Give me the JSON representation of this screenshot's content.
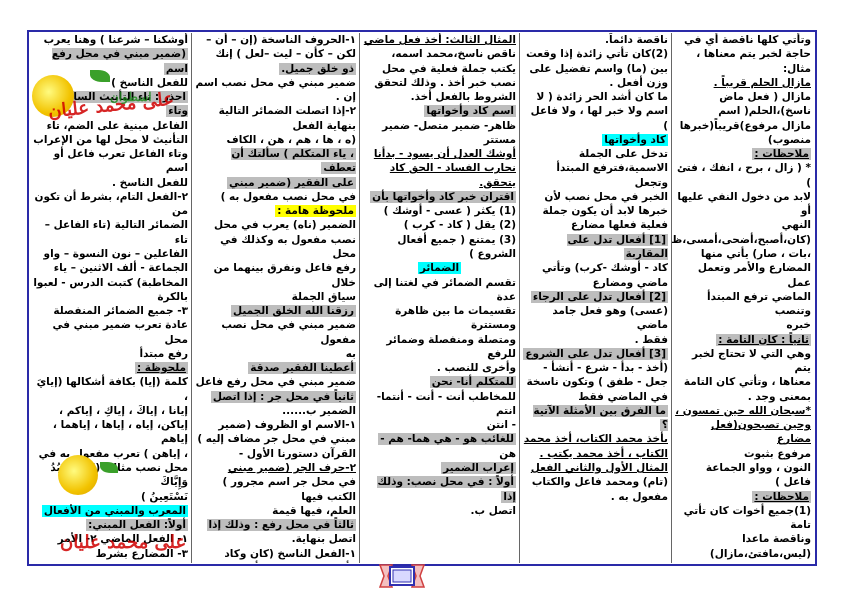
{
  "columns": [
    {
      "lines": [
        {
          "t": "وتأتي كلها ناقصة أي في"
        },
        {
          "t": "حاجة لخبر يتم معناها ، مثال:"
        },
        {
          "t": "مازال الحلم قريباً .",
          "u": 1
        },
        {
          "t": "مازال ( فعل ماض"
        },
        {
          "t": "ناسخ)،الحلم( اسم"
        },
        {
          "t": "مازال مرفوع)قريباً(خبرها"
        },
        {
          "t": "منصوب)"
        },
        {
          "t": "ملاحظات :",
          "h": "gray",
          "u": 1
        },
        {
          "t": "* ( زال ، برح ، انفك ، فتئ )"
        },
        {
          "t": "لابد من دخول النفي عليها أو"
        },
        {
          "t": "النهي"
        },
        {
          "t": "(كان،أصبح،أضحى،أمسى،ظل"
        },
        {
          "t": "،بات ، صار) يأتي منها"
        },
        {
          "t": "المضارع والأمر وتعمل عمل"
        },
        {
          "t": "الماضي ترفع المبتدأ وتنصب"
        },
        {
          "t": "خبره"
        },
        {
          "t": "ثانياً : كان التامة :",
          "h": "gray",
          "u": 1
        },
        {
          "t": "وهي التي لا تحتاج لخبر يتم"
        },
        {
          "t": "معناها ، وتأتي كان التامة"
        },
        {
          "t": "بمعنى وجد ."
        },
        {
          "t": "*سبحان الله حين تمسون ،",
          "u": 1
        },
        {
          "t": "وحين تصبحون(فعل مضارع",
          "u": 1
        },
        {
          "t": "مرفوع بثبوت"
        },
        {
          "t": "النون ، وواو الجماعة فاعل )"
        },
        {
          "t": "ملاحظات :",
          "h": "gray",
          "u": 1
        },
        {
          "t": "(1)جميع أخوات كان تأتي"
        },
        {
          "t": "تامة"
        },
        {
          "t": "وناقصة ماعدا"
        },
        {
          "t": "(ليس،مافتئ،مازال)"
        }
      ]
    },
    {
      "lines": [
        {
          "t": "ناقصة دائماً."
        },
        {
          "t": "(2)كان تأتي زائدة إذا وقعت"
        },
        {
          "t": "بين (ما) واسم تفضيل على"
        },
        {
          "t": "وزن أفعل ."
        },
        {
          "t": "ما كان أشد الحر زائدة ( لا"
        },
        {
          "t": "اسم ولا خبر لها ، ولا فاعل )"
        },
        {
          "t": "كاد وأخواتها",
          "h": "cyan"
        },
        {
          "t": "تدخل على الجملة"
        },
        {
          "t": "الاسمية،فترفع المبتدأ وتجعل"
        },
        {
          "t": "الخبر في محل نصب لأن"
        },
        {
          "t": "خبرها لابد أن يكون جملة"
        },
        {
          "t": "فعلية فعلها مضارع"
        },
        {
          "t": "[1] أفعال تدل على المقاربة",
          "h": "gray"
        },
        {
          "t": "كاد - أوشك -كرب) وتأتي"
        },
        {
          "t": "ماضي ومضارع"
        },
        {
          "t": "[2] أفعال تدل على الرجاء",
          "h": "gray"
        },
        {
          "t": "(عسى) وهو فعل جامد ماضي"
        },
        {
          "t": "فقط ."
        },
        {
          "t": "[3] أفعال تدل على الشروع",
          "h": "gray"
        },
        {
          "t": "(أخذ - بدأ - شرع - أنشأ -"
        },
        {
          "t": "جعل - طفق ) وتكون ناسخة"
        },
        {
          "t": "في الماضي فقط"
        },
        {
          "t": "ما الفرق بين الأمثلة الآتية ؟",
          "h": "gray"
        },
        {
          "t": "يأخذ محمد الكتاب، أخذ محمد",
          "u": 1
        },
        {
          "t": "الكتاب ، أخذ محمد يكتب .",
          "u": 1
        },
        {
          "t": "المثال الأول والثاني الفعل",
          "u": 1
        },
        {
          "t": "(تام) ومحمد فاعل والكتاب"
        },
        {
          "t": "مفعول به ."
        }
      ]
    },
    {
      "lines": [
        {
          "t": "المثال الثالث: أخذ فعل ماضي",
          "u": 1
        },
        {
          "t": "ناقص ناسخ،محمد اسمه،"
        },
        {
          "t": "يكتب جملة فعلية في محل"
        },
        {
          "t": "نصب خبر أخذ . وذلك لتحقق"
        },
        {
          "t": "الشروط بالفعل أخذ."
        },
        {
          "t": "اسم كاد وأخواتها",
          "h": "gray"
        },
        {
          "t": "ظاهر- ضمير متصل- ضمير"
        },
        {
          "t": "مستتر"
        },
        {
          "t": "أوشك العدل أن يسود - بدأنا",
          "u": 1
        },
        {
          "t": "نحارب الفساد - الحق كاد",
          "u": 1
        },
        {
          "t": "يتحقق.",
          "u": 1
        },
        {
          "t": "اقتران خبر كاد وأخواتها بأن",
          "h": "gray"
        },
        {
          "t": "(1) يكثر ( عسى - أوشك )"
        },
        {
          "t": "(2) يقل ( كاد - كرب )"
        },
        {
          "t": "(3) يمتنع ( جميع أفعال"
        },
        {
          "t": "الشروع )"
        },
        {
          "t": "الضمائر",
          "h": "cyan",
          "c": 1
        },
        {
          "t": "تقسم الضمائر في لغتنا إلى عدة"
        },
        {
          "t": "تقسيمات ما بين ظاهرة ومستترة"
        },
        {
          "t": "ومتصلة ومنفصلة وضمائر للرفع"
        },
        {
          "t": "وأخرى للنصب ."
        },
        {
          "t": "للمتكلم          أنا- نحن",
          "h": "gray"
        },
        {
          "t": "للمخاطب أنت - أنت - أنتما- انتم"
        },
        {
          "t": "- انتن"
        },
        {
          "t": "للغائب       هو - هي هما- هم -",
          "h": "gray"
        },
        {
          "t": "هن"
        },
        {
          "t": "إعراب الضمير",
          "h": "gray"
        },
        {
          "t": "أولاً : في محل نصب: وذلك إذا",
          "h": "gray"
        },
        {
          "t": "اتصل ب."
        }
      ]
    },
    {
      "lines": [
        {
          "t": "١-الحروف الناسخة (إن – أن –"
        },
        {
          "t": "لكن – كأن – ليت –لعل ) إنك"
        },
        {
          "t": "ذو خلق جميل.",
          "h": "gray"
        },
        {
          "t": "ضمير مبني في محل نصب اسم"
        },
        {
          "t": "إن ."
        },
        {
          "t": "٢-إذا اتصلت الضمائر التالية"
        },
        {
          "t": "بنهاية الفعل"
        },
        {
          "t": "(ه ، ها ، هم ، هن ، الكاف"
        },
        {
          "t": "، ياء المتكلم ) سألتك أن تعطف",
          "h": "gray"
        },
        {
          "t": "على الفقير (ضمير مبني",
          "h": "gray"
        },
        {
          "t": "في محل نصب مفعول به )"
        },
        {
          "t": "ملحوظة هامة :",
          "h": "yellow"
        },
        {
          "t": "الضمير (ناه) يعرب في محل"
        },
        {
          "t": "نصب مفعول به وكذلك في محل"
        },
        {
          "t": "رفع فاعل ونفرق بينهما من خلال"
        },
        {
          "t": "سياق الجملة"
        },
        {
          "t": "رزقنا الله الخلق الجميل",
          "h": "gray"
        },
        {
          "t": "ضمير مبني في محل نصب مفعول"
        },
        {
          "t": "به"
        },
        {
          "t": "أعطينا الفقير صدقة",
          "h": "gray"
        },
        {
          "t": "ضمير مبني في محل رفع فاعل"
        },
        {
          "t": "ثانياً في محل جر : إذا اتصل",
          "h": "gray"
        },
        {
          "t": "الضمير ب......"
        },
        {
          "t": "١-الاسم او الظروف (ضمير"
        },
        {
          "t": "مبني في محل جر مضاف إليه )"
        },
        {
          "t": "القرآن دستورنا الأول -"
        },
        {
          "t": "٢-حرف الجر (ضمير مبني",
          "u": 1
        },
        {
          "t": "في محل جر اسم مجرور ) الكتب فيها"
        },
        {
          "t": "العلم، فيها قيمة"
        },
        {
          "t": "ثالثاً في محل رفع : وذلك إذا",
          "h": "gray"
        },
        {
          "t": "اتصل بنهاية."
        },
        {
          "t": "١-الفعل الناسخ (كان وكاد"
        },
        {
          "t": "وأخواتهما) (كنتم - أصبحت -"
        }
      ]
    },
    {
      "lines": [
        {
          "t": "أوشكنا – شرعنا ) وهنا يعرب"
        },
        {
          "t": "(ضمير مبني في محل رفع اسم",
          "h": "gray"
        },
        {
          "t": "للفعل الناسخ )"
        },
        {
          "t": "احذر : تاء التأنيث الساكنة وتاء",
          "h": "gray"
        },
        {
          "t": "الفاعل مبنية على الضم، تاء"
        },
        {
          "t": "التأنيث لا محل لها من الإعراب"
        },
        {
          "t": "وتاء الفاعل تعرب فاعل أو اسم"
        },
        {
          "t": "للفعل الناسخ ."
        },
        {
          "t": "٢-الفعل التام، بشرط أن تكون من"
        },
        {
          "t": "الضمائر التالية (تاء الفاعل –تاء"
        },
        {
          "t": "الفاعلين – نون النسوة – واو"
        },
        {
          "t": "الجماعة - ألف الاثنين – ياء"
        },
        {
          "t": "المخاطبة) كتبت الدرس - لعبوا"
        },
        {
          "t": "بالكرة"
        },
        {
          "t": "٣- جميع الضمائر المنفصلة"
        },
        {
          "t": "عادة تعرب ضمير مبني في محل"
        },
        {
          "t": "رفع مبتدأ"
        },
        {
          "t": "ملحوظة :",
          "h": "gray",
          "u": 1
        },
        {
          "t": "كلمة (إيا) بكافة أشكالها (إيايَ ،"
        },
        {
          "t": "إيانا ، إياكَ ، إياكِ ، إياكم ،"
        },
        {
          "t": "إياكن، إياه ، إياها ، إياهما ، إياهم"
        },
        {
          "t": "، إياهن ) تعرب مفعول به في"
        },
        {
          "t": "محل نصب مثال: (إيَّاكَ نَعْبُدُ وَإِيَّاكَ"
        },
        {
          "t": "نَسْتَعِينُ )"
        },
        {
          "t": "المعرب والمبني من الأفعال",
          "h": "cyan"
        },
        {
          "t": "أولاً: الفعل المبني:",
          "h": "gray"
        },
        {
          "t": "١- الفعل الماضي        ٢- الأمر"
        },
        {
          "t": "٣- المضارع بشرط"
        },
        {
          "t": "اتصاله بنون النسوة(الطالبات"
        },
        {
          "t": "يرسمن..."
        },
        {
          "t": "فعل مضارع مبني على",
          "cls": "red"
        },
        {
          "t": "السكون          استوان",
          "cls": "red"
        }
      ]
    }
  ],
  "watermark": {
    "line1": "على محمد عليان",
    "line2": "اسطوان",
    "line3": "فعل مضارع مبني على السكون"
  },
  "nav_icon": "ribbon-nav-icon",
  "accent_colors": {
    "border": "#2a2aa8",
    "gray": "#bdbdbd",
    "cyan": "#00ffff",
    "yellow": "#ffff00",
    "red": "#d00000"
  }
}
